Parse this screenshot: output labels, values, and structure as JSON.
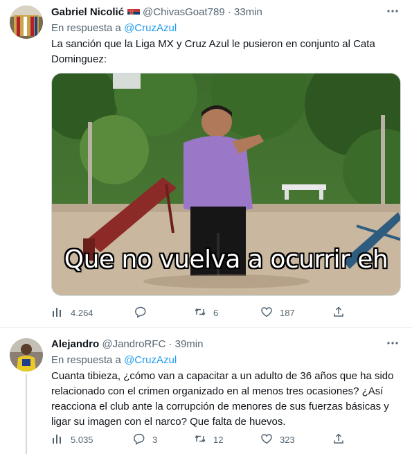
{
  "tweets": [
    {
      "author_name": "Gabriel Nicolić",
      "handle": "@ChivasGoat789",
      "time": "33min",
      "reply_prefix": "En respuesta a",
      "reply_to": "@CruzAzul",
      "text": "La sanción que la Liga MX y Cruz Azul le pusieron en conjunto al Cata Dominguez:",
      "media_caption": "Que no vuelva a ocurrir eh",
      "stats": {
        "views": "4.264",
        "replies": "",
        "retweets": "6",
        "likes": "187"
      }
    },
    {
      "author_name": "Alejandro",
      "handle": "@JandroRFC",
      "time": "39min",
      "reply_prefix": "En respuesta a",
      "reply_to": "@CruzAzul",
      "text": "Cuanta tibieza, ¿cómo van a capacitar a un adulto de 36 años que ha sido relacionado con el crimen organizado en al menos tres ocasiones? ¿Así reacciona el club ante la corrupción de menores de sus fuerzas básicas y ligar su imagen con el narco? Que falta de huevos.",
      "stats": {
        "views": "5.035",
        "replies": "3",
        "retweets": "12",
        "likes": "323"
      }
    }
  ],
  "separator": "·",
  "colors": {
    "text": "#0f1419",
    "muted": "#536471",
    "link": "#1d9bf0",
    "border": "#eff3f4"
  },
  "icons": [
    "more-icon",
    "views-icon",
    "reply-icon",
    "retweet-icon",
    "like-icon",
    "share-icon",
    "serbia-flag-icon"
  ]
}
